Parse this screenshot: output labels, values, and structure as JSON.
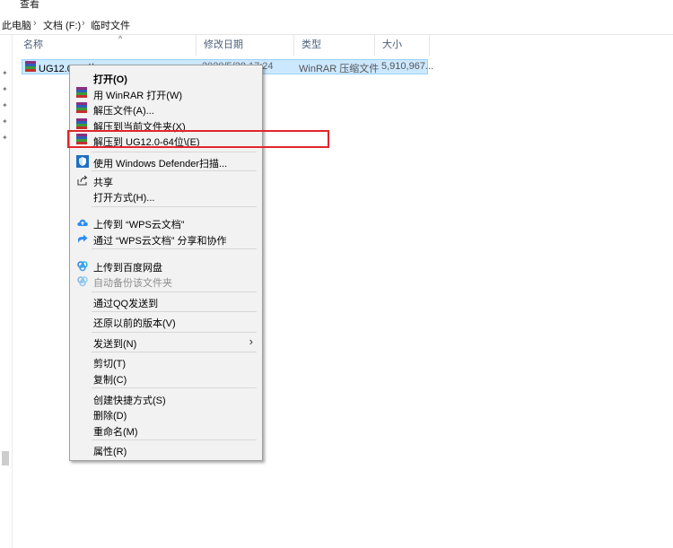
{
  "ribbon": {
    "view_tab": "查看"
  },
  "breadcrumb": {
    "items": [
      "此电脑",
      "文档 (F:)",
      "临时文件"
    ],
    "separator": "›"
  },
  "columns": [
    "名称",
    "修改日期",
    "类型",
    "大小"
  ],
  "file": {
    "name": "UG12.0-64位",
    "date": "2020/5/28 17:24",
    "type": "WinRAR 压缩文件",
    "size": "5,910,967..."
  },
  "context_menu": {
    "open": "打开(O)",
    "open_winrar": "用 WinRAR 打开(W)",
    "extract_files": "解压文件(A)...",
    "extract_here": "解压到当前文件夹(X)",
    "extract_to": "解压到 UG12.0-64位\\(E)",
    "defender_scan": "使用 Windows Defender扫描...",
    "share": "共享",
    "open_with": "打开方式(H)...",
    "wps_upload": "上传到 “WPS云文档”",
    "wps_share": "通过 “WPS云文档” 分享和协作",
    "baidu_upload": "上传到百度网盘",
    "baidu_backup": "自动备份该文件夹",
    "qq_send": "通过QQ发送到",
    "restore_prev": "还原以前的版本(V)",
    "send_to": "发送到(N)",
    "cut": "剪切(T)",
    "copy": "复制(C)",
    "create_shortcut": "创建快捷方式(S)",
    "delete": "删除(D)",
    "rename": "重命名(M)",
    "properties": "属性(R)"
  },
  "colors": {
    "selection_bg": "#cce8ff",
    "highlight_border": "#e0262a",
    "menu_bg": "#f2f2f2"
  }
}
